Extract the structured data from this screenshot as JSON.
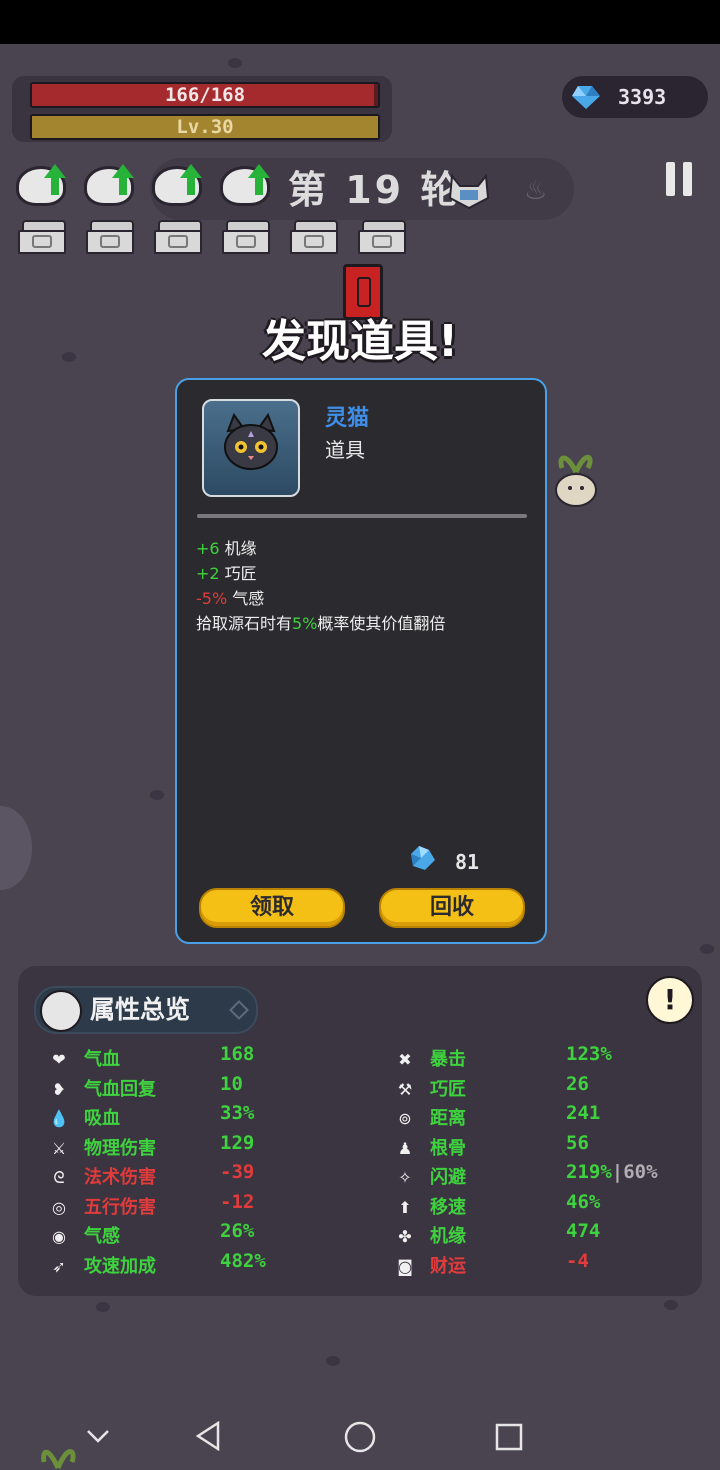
{
  "hud": {
    "hp_text": "166/168",
    "hp_fraction": 0.988,
    "level_text": "Lv.30",
    "level_fraction": 1.0,
    "currency": "3393",
    "round_text": "第 19 轮"
  },
  "upgrades_count": 4,
  "chests_count": 6,
  "popup": {
    "title": "发现道具!",
    "item_name": "灵猫",
    "item_type": "道具",
    "effects": [
      {
        "value": "+6",
        "label": " 机缘",
        "color": "#3ed33e"
      },
      {
        "value": "+2",
        "label": " 巧匠",
        "color": "#3ed33e"
      },
      {
        "value": "-5%",
        "label": " 气感",
        "color": "#e23b3b"
      }
    ],
    "desc_pre": "拾取源石时有",
    "desc_pct": "5%",
    "desc_post": "概率使其价值翻倍",
    "price": "81",
    "claim_label": "领取",
    "recycle_label": "回收"
  },
  "attributes": {
    "title": "属性总览",
    "info_glyph": "!",
    "left": [
      {
        "icon": "heart",
        "glyph": "❤",
        "name": "气血",
        "name_color": "#3ed33e",
        "value": "168",
        "value_color": "#3ed33e"
      },
      {
        "icon": "heart-regen",
        "glyph": "❥",
        "name": "气血回复",
        "name_color": "#3ed33e",
        "value": "10",
        "value_color": "#3ed33e"
      },
      {
        "icon": "drop",
        "glyph": "💧",
        "name": "吸血",
        "name_color": "#3ed33e",
        "value": "33%",
        "value_color": "#3ed33e"
      },
      {
        "icon": "sword",
        "glyph": "⚔",
        "name": "物理伤害",
        "name_color": "#3ed33e",
        "value": "129",
        "value_color": "#3ed33e"
      },
      {
        "icon": "spiral",
        "glyph": "ᘓ",
        "name": "法术伤害",
        "name_color": "#e23b3b",
        "value": "-39",
        "value_color": "#e23b3b"
      },
      {
        "icon": "swirl",
        "glyph": "◎",
        "name": "五行伤害",
        "name_color": "#e23b3b",
        "value": "-12",
        "value_color": "#e23b3b"
      },
      {
        "icon": "aura",
        "glyph": "◉",
        "name": "气感",
        "name_color": "#3ed33e",
        "value": "26%",
        "value_color": "#3ed33e"
      },
      {
        "icon": "attack-speed",
        "glyph": "➶",
        "name": "攻速加成",
        "name_color": "#3ed33e",
        "value": "482%",
        "value_color": "#3ed33e"
      }
    ],
    "right": [
      {
        "icon": "crit",
        "glyph": "✖",
        "name": "暴击",
        "name_color": "#3ed33e",
        "value": "123%",
        "value_color": "#3ed33e"
      },
      {
        "icon": "hammer",
        "glyph": "⚒",
        "name": "巧匠",
        "name_color": "#3ed33e",
        "value": "26",
        "value_color": "#3ed33e"
      },
      {
        "icon": "target",
        "glyph": "⊚",
        "name": "距离",
        "name_color": "#3ed33e",
        "value": "241",
        "value_color": "#3ed33e"
      },
      {
        "icon": "person",
        "glyph": "♟",
        "name": "根骨",
        "name_color": "#3ed33e",
        "value": "56",
        "value_color": "#3ed33e"
      },
      {
        "icon": "run",
        "glyph": "✧",
        "name": "闪避",
        "name_color": "#3ed33e",
        "value": "219%",
        "value_color": "#3ed33e",
        "suffix": "|60%",
        "suffix_color": "#b0adb4"
      },
      {
        "icon": "boot",
        "glyph": "⬆",
        "name": "移速",
        "name_color": "#3ed33e",
        "value": "46%",
        "value_color": "#3ed33e"
      },
      {
        "icon": "clover",
        "glyph": "✤",
        "name": "机缘",
        "name_color": "#3ed33e",
        "value": "474",
        "value_color": "#3ed33e"
      },
      {
        "icon": "coin",
        "glyph": "◙",
        "name": "财运",
        "name_color": "#e23b3b",
        "value": "-4",
        "value_color": "#e23b3b"
      }
    ]
  },
  "nav": {
    "items": [
      "chevron-down",
      "back",
      "home",
      "recent"
    ]
  }
}
